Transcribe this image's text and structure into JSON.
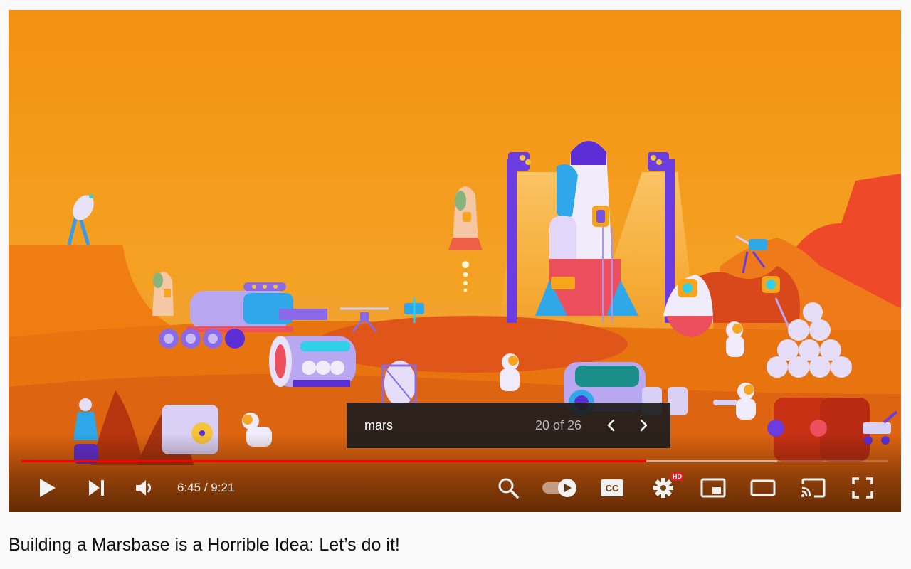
{
  "video": {
    "title": "Building a Marsbase is a Horrible Idea: Let’s do it!",
    "current_time": "6:45",
    "duration": "9:21",
    "time_display": "6:45 / 9:21",
    "progress_fraction": 0.721,
    "buffered_fraction": 0.872,
    "scene_description": "Kurzgesagt-style illustration of a Mars base: launch pad rocket with light towers, rover, habitat modules, astronauts, satellite dish, drone"
  },
  "transcript_search": {
    "query": "mars",
    "match_label": "20 of 26",
    "current_match": 20,
    "total_matches": 26,
    "prev_icon": "chevron-left-icon",
    "next_icon": "chevron-right-icon"
  },
  "controls": {
    "left": [
      {
        "name": "play-button",
        "icon": "play-icon"
      },
      {
        "name": "next-button",
        "icon": "skip-next-icon"
      },
      {
        "name": "mute-button",
        "icon": "volume-icon"
      }
    ],
    "right": [
      {
        "name": "search-button",
        "icon": "search-icon"
      },
      {
        "name": "autoplay-toggle",
        "icon": "autoplay-toggle-icon",
        "state": "on"
      },
      {
        "name": "subtitles-button",
        "icon": "cc-icon",
        "label": "CC"
      },
      {
        "name": "settings-button",
        "icon": "gear-icon",
        "badge": "HD"
      },
      {
        "name": "miniplayer-button",
        "icon": "miniplayer-icon"
      },
      {
        "name": "theater-mode-button",
        "icon": "theater-icon"
      },
      {
        "name": "cast-button",
        "icon": "cast-icon"
      },
      {
        "name": "fullscreen-button",
        "icon": "fullscreen-icon"
      }
    ]
  },
  "colors": {
    "sky": "#f39312",
    "sky_light": "#f6b232",
    "ground": "#e8740f",
    "ground_dark": "#d04a10",
    "cliff_red": "#ee4a2a",
    "accent_purple": "#6b3ce0",
    "accent_blue": "#2fa7e8",
    "rocket_white": "#f1ecfb",
    "rocket_red": "#ee4f5d",
    "progress_red": "#ff0000",
    "hd_badge": "#e31b23"
  }
}
